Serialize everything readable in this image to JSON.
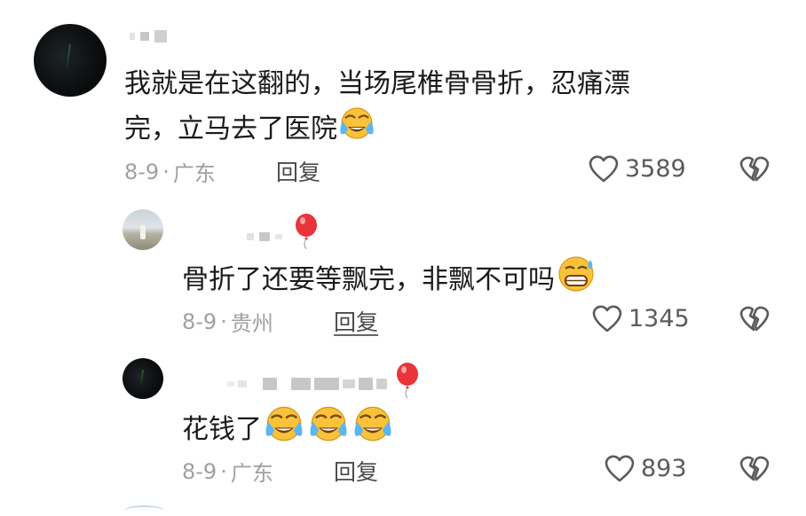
{
  "comments": [
    {
      "text_line1": "我就是在这翻的，当场尾椎骨骨折，忍痛漂",
      "text_line2": "完，立马去了医院",
      "date": "8-9",
      "sep": "·",
      "location": "广东",
      "reply": "回复",
      "likes": "3589",
      "emoji_count": 1
    },
    {
      "text": "骨折了还要等飘完，非飘不可吗",
      "date": "8-9",
      "sep": "·",
      "location": "贵州",
      "reply": "回复",
      "likes": "1345",
      "emoji_count": 1
    },
    {
      "text": "花钱了",
      "date": "8-9",
      "sep": "·",
      "location": "广东",
      "reply": "回复",
      "likes": "893",
      "emoji_count": 3
    }
  ],
  "icons": {
    "like": "heart-outline-icon",
    "dislike": "broken-heart-icon",
    "emoji_cry": "crying-laughing-emoji",
    "emoji_sweat": "grin-sweat-emoji",
    "balloon": "red-balloon-icon"
  },
  "colors": {
    "text": "#1a1a1a",
    "meta": "#a0a0a0",
    "balloon": "#e8343a"
  }
}
